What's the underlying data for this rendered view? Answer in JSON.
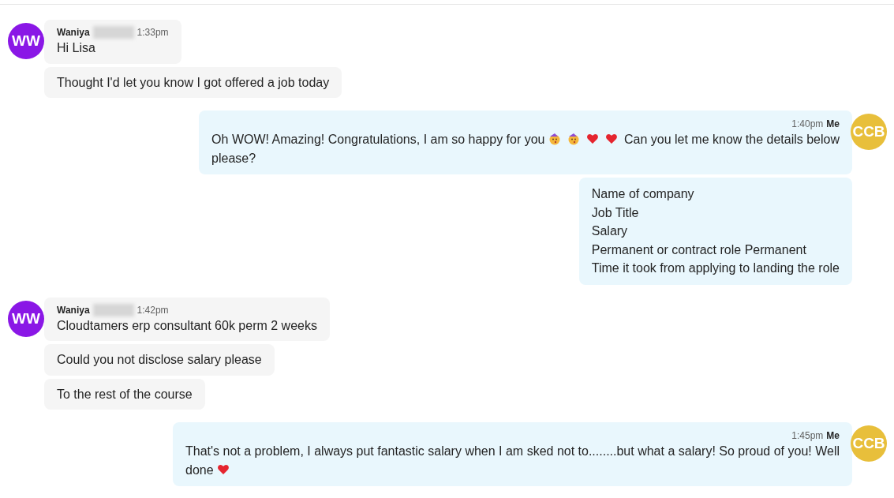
{
  "groups": [
    {
      "kind": "incoming",
      "avatar": "WW",
      "color": "#8a17e6",
      "sender": "Waniya",
      "name_redacted": true,
      "time": "1:33pm",
      "messages": [
        {
          "lines": [
            [
              {
                "kind": "text",
                "text": "Hi Lisa"
              }
            ]
          ]
        },
        {
          "lines": [
            [
              {
                "kind": "text",
                "text": "Thought I'd let you know I got offered a job today"
              }
            ]
          ]
        }
      ]
    },
    {
      "kind": "outgoing",
      "avatar": "CCB",
      "color": "#e8bf3b",
      "sender": "Me",
      "name_redacted": false,
      "time": "1:40pm",
      "messages": [
        {
          "lines": [
            [
              {
                "kind": "text",
                "text": "Oh WOW! Amazing! Congratulations, I am so happy for you"
              },
              {
                "kind": "face"
              },
              {
                "kind": "face"
              },
              {
                "kind": "heart"
              },
              {
                "kind": "heart"
              },
              {
                "kind": "text",
                "text": "Can you let me know the details below"
              }
            ],
            [
              {
                "kind": "text",
                "text": "please?"
              }
            ]
          ]
        },
        {
          "lines": [
            [
              {
                "kind": "text",
                "text": "Name of company"
              }
            ],
            [
              {
                "kind": "text",
                "text": "Job Title"
              }
            ],
            [
              {
                "kind": "text",
                "text": "Salary"
              }
            ],
            [
              {
                "kind": "text",
                "text": "Permanent or contract role Permanent"
              }
            ],
            [
              {
                "kind": "text",
                "text": "Time it took from applying to landing the role"
              }
            ]
          ]
        }
      ]
    },
    {
      "kind": "incoming",
      "avatar": "WW",
      "color": "#8a17e6",
      "sender": "Waniya",
      "name_redacted": true,
      "time": "1:42pm",
      "messages": [
        {
          "lines": [
            [
              {
                "kind": "text",
                "text": "Cloudtamers erp consultant 60k perm 2 weeks"
              }
            ]
          ]
        },
        {
          "lines": [
            [
              {
                "kind": "text",
                "text": "Could you not disclose salary please"
              }
            ]
          ]
        },
        {
          "lines": [
            [
              {
                "kind": "text",
                "text": "To the rest of the course"
              }
            ]
          ]
        }
      ]
    },
    {
      "kind": "outgoing",
      "avatar": "CCB",
      "color": "#e8bf3b",
      "sender": "Me",
      "name_redacted": false,
      "time": "1:45pm",
      "messages": [
        {
          "lines": [
            [
              {
                "kind": "text",
                "text": "That's not a problem, I always put fantastic salary when I am sked not to........but what a salary! So proud of you! Well"
              }
            ],
            [
              {
                "kind": "text",
                "text": "done"
              },
              {
                "kind": "heart"
              }
            ]
          ]
        }
      ]
    }
  ]
}
